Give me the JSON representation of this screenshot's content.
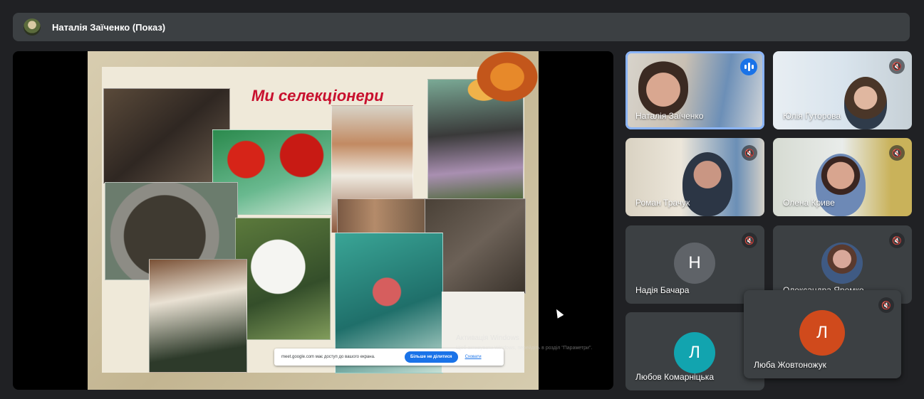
{
  "header": {
    "presenter_title": "Наталія Заїченко (Показ)"
  },
  "presentation": {
    "slide_title": "Ми селекціонери",
    "share_banner": {
      "message": "meet.google.com має доступ до вашого екрана.",
      "stop_label": "Більше не ділитися",
      "hide_label": "Сховати"
    },
    "watermark_title": "Активація Windows",
    "watermark_subtitle": "Щоб активувати Windows, перейдіть в розділ \"Параметри\"."
  },
  "participants": [
    {
      "name": "Наталія Заїченко",
      "speaking": true
    },
    {
      "name": "Юлія Гуторова",
      "muted": true
    },
    {
      "name": "Роман Трачук",
      "muted": true
    },
    {
      "name": "Олена Криве",
      "muted": true
    },
    {
      "name": "Надія Бачара",
      "initial": "Н",
      "muted": true
    },
    {
      "name": "Олександра Яремко",
      "muted": true
    },
    {
      "name": "Любов Комарніцька",
      "initial": "Л"
    },
    {
      "name": "Люба Жовтоножук",
      "initial": "Л",
      "muted": true
    }
  ],
  "colors": {
    "background": "#202124",
    "tile": "#3c4043",
    "active_outline": "#8ab4f8",
    "avatar_gray": "#5f6368",
    "avatar_teal": "#12a4af",
    "avatar_orange": "#d04a1c"
  },
  "icons": {
    "mic_off": "mic-off-icon",
    "speaking": "audio-level-icon"
  }
}
